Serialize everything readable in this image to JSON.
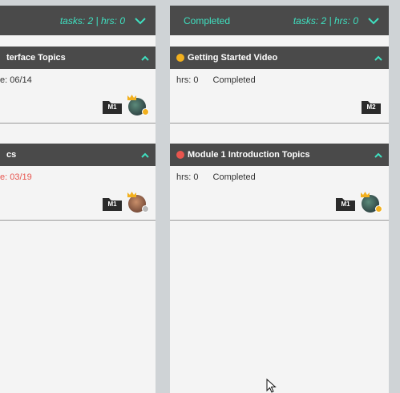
{
  "colors": {
    "accent": "#3fe0c0",
    "header_bg": "#4a4a4a",
    "card_bg": "#f4f4f4",
    "dot_yellow": "#f2b01e",
    "dot_red": "#e8554e",
    "badge_yellow": "#f2b01e",
    "badge_gray": "#b9b9b9",
    "overdue": "#e8554e"
  },
  "left_column": {
    "meta": "tasks: 2 | hrs: 0",
    "cards": [
      {
        "title": "terface Topics",
        "due": "e: 06/14",
        "folder": "M1",
        "avatar_badge": "yellow"
      },
      {
        "title": "cs",
        "due": "e: 03/19",
        "folder": "M1",
        "avatar_badge": "gray"
      }
    ]
  },
  "right_column": {
    "title": "Completed",
    "meta": "tasks: 2 | hrs: 0",
    "cards": [
      {
        "title": "Getting Started Video",
        "dot": "yellow",
        "hrs": "hrs: 0",
        "status": "Completed",
        "folder": "M2"
      },
      {
        "title": "Module 1 Introduction Topics",
        "dot": "red",
        "hrs": "hrs: 0",
        "status": "Completed",
        "folder": "M1",
        "avatar_badge": "yellow"
      }
    ]
  },
  "icons": {
    "expand": "chevron-down-icon",
    "collapse": "chevron-up-icon",
    "folder": "folder-icon",
    "crown": "crown-icon",
    "cursor": "mouse-cursor-icon"
  }
}
